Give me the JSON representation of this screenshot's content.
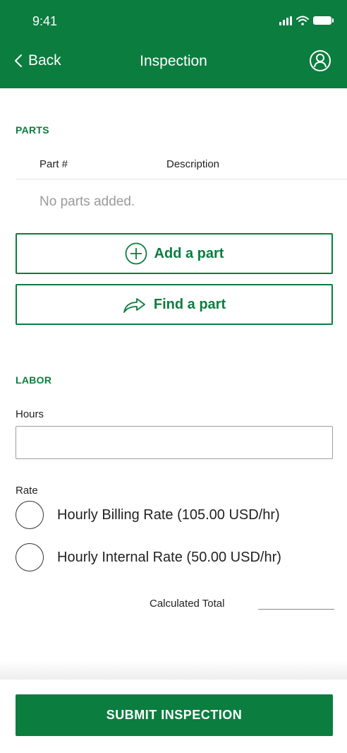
{
  "status_bar": {
    "time": "9:41"
  },
  "nav": {
    "back_label": "Back",
    "title": "Inspection",
    "profile_icon": "user-circle-icon"
  },
  "parts": {
    "section_title": "PARTS",
    "columns": [
      "Part #",
      "Description"
    ],
    "empty_message": "No parts added.",
    "add_button_label": "Add a part",
    "find_button_label": "Find a part"
  },
  "labor": {
    "section_title": "LABOR",
    "hours_label": "Hours",
    "hours_value": "",
    "rate_label": "Rate",
    "rate_options": [
      {
        "label": "Hourly Billing Rate (105.00 USD/hr)",
        "selected": false
      },
      {
        "label": "Hourly Internal Rate (50.00 USD/hr)",
        "selected": false
      }
    ],
    "calculated_total_label": "Calculated Total",
    "calculated_total_value": ""
  },
  "submit_label": "SUBMIT INSPECTION",
  "colors": {
    "brand": "#0b7d3f",
    "muted_text": "#9a9a9a"
  }
}
